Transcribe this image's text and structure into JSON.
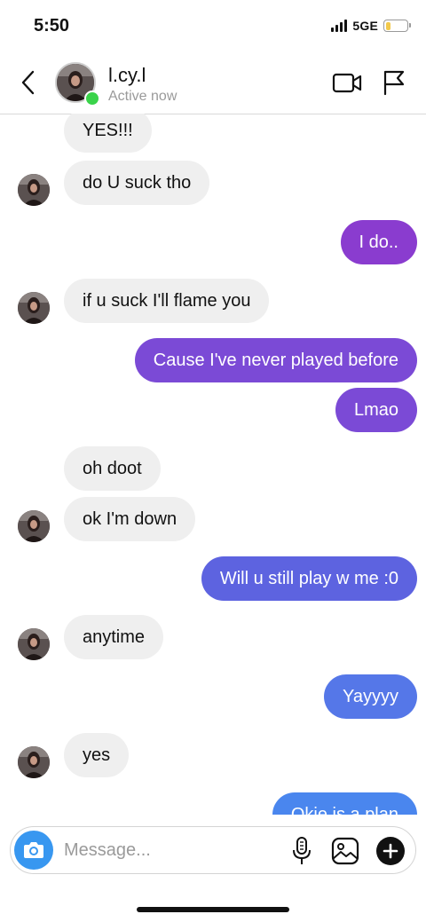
{
  "status_bar": {
    "time": "5:50",
    "network": "5GE",
    "battery_level": 0.25
  },
  "header": {
    "name": "l.cy.l",
    "status": "Active now"
  },
  "messages": [
    {
      "text": "YES!!!",
      "sender": "them"
    },
    {
      "text": "do U suck tho",
      "sender": "them"
    },
    {
      "text": "I do..",
      "sender": "me",
      "color": "#8a3ccf"
    },
    {
      "text": "if u suck I'll flame you",
      "sender": "them"
    },
    {
      "text": "Cause I've never played before",
      "sender": "me",
      "color": "#7b4ad6"
    },
    {
      "text": "Lmao",
      "sender": "me",
      "color": "#7b4ad6"
    },
    {
      "text": "oh doot",
      "sender": "them"
    },
    {
      "text": "ok I'm down",
      "sender": "them"
    },
    {
      "text": "Will u still play w me :0",
      "sender": "me",
      "color": "#5d63e0"
    },
    {
      "text": "anytime",
      "sender": "them"
    },
    {
      "text": "Yayyyy",
      "sender": "me",
      "color": "#5577e8"
    },
    {
      "text": "yes",
      "sender": "them"
    },
    {
      "text": "Okie is a plan",
      "sender": "me",
      "color": "#4a86ee"
    }
  ],
  "composer": {
    "placeholder": "Message..."
  },
  "colors": {
    "accent": "#3897f0",
    "online": "#3ad34a",
    "incoming_bubble": "#efefef"
  },
  "icons": {
    "back": "chevron-left-icon",
    "video": "video-camera-icon",
    "flag": "flag-icon",
    "camera": "camera-icon",
    "mic": "microphone-icon",
    "gallery": "image-icon",
    "plus": "plus-icon"
  }
}
